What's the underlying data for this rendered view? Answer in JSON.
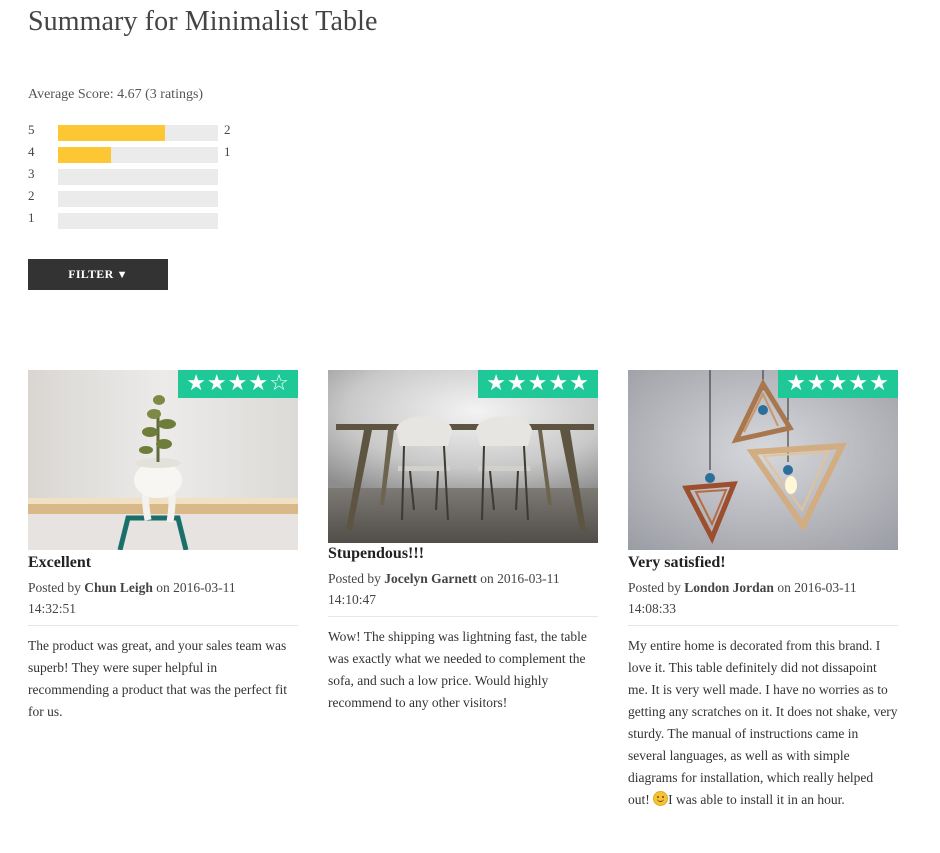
{
  "page": {
    "title": "Summary for Minimalist Table"
  },
  "summary": {
    "average_label": "Average Score: 4.67 (3 ratings)",
    "distribution": [
      {
        "stars": "5",
        "count": "2",
        "fraction": 0.667
      },
      {
        "stars": "4",
        "count": "1",
        "fraction": 0.333
      },
      {
        "stars": "3",
        "count": "",
        "fraction": 0
      },
      {
        "stars": "2",
        "count": "",
        "fraction": 0
      },
      {
        "stars": "1",
        "count": "",
        "fraction": 0
      }
    ],
    "bar_color": "#fdc633",
    "track_color": "#ebebeb"
  },
  "filter": {
    "label": "FILTER",
    "arrow": "▼"
  },
  "colors": {
    "star_badge": "#1ec997",
    "button": "#333333"
  },
  "reviews": [
    {
      "rating": 4,
      "stars_text": "★★★★☆",
      "title": "Excellent",
      "posted_by": "Posted by",
      "author": "Chun Leigh",
      "on": "on",
      "date": "2016-03-11",
      "time": "14:32:51",
      "body": "The product was great, and your sales team was superb! They were super helpful in recommending a product that was the perfect fit for us."
    },
    {
      "rating": 5,
      "stars_text": "★★★★★",
      "title": "Stupendous!!!",
      "posted_by": "Posted by",
      "author": "Jocelyn Garnett",
      "on": "on",
      "date": "2016-03-11",
      "time": "14:10:47",
      "body": "Wow! The shipping was lightning fast, the table was exactly what we needed to complement the sofa, and such a low price. Would highly recommend to any other visitors!"
    },
    {
      "rating": 5,
      "stars_text": "★★★★★",
      "title": "Very satisfied!",
      "posted_by": "Posted by",
      "author": "London Jordan",
      "on": "on",
      "date": "2016-03-11",
      "time": "14:08:33",
      "body_before_emoji": "My entire home is decorated from this brand. I love it. This table definitely did not dissapoint me. It is very well made. I have no worries as to getting any scratches on it. It does not shake, very sturdy. The manual of instructions came in several languages, as well as with simple diagrams for installation, which really helped out! ",
      "emoji": "smiley-face-icon",
      "body_after_emoji": "I was able to install it in an hour."
    }
  ]
}
